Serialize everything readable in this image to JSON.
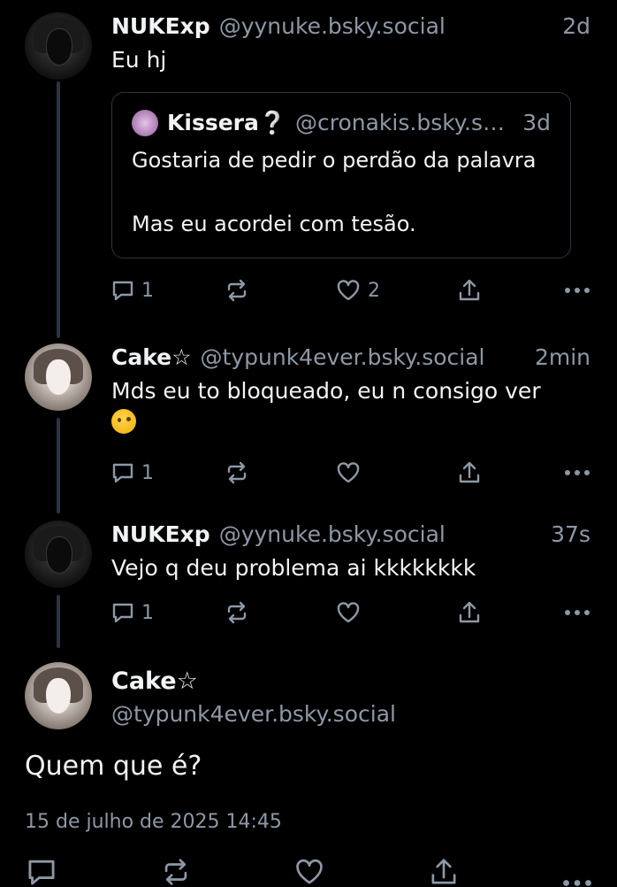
{
  "thread": [
    {
      "name": "NUKExp",
      "handle": "@yynuke.bsky.social",
      "time": "2d",
      "text": "Eu hj",
      "quote": {
        "name": "Kissera❔",
        "handle": "@cronakis.bsky.so...",
        "time": "3d",
        "text": "Gostaria de pedir o perdão da palavra\n\nMas eu acordei com tesão."
      },
      "reply_count": "1",
      "like_count": "2"
    },
    {
      "name": "Cake☆",
      "handle": "@typunk4ever.bsky.social",
      "time": "2min",
      "text": "Mds eu to bloqueado, eu n consigo ver",
      "emoji": "face-with-raised-eyebrow",
      "reply_count": "1"
    },
    {
      "name": "NUKExp",
      "handle": "@yynuke.bsky.social",
      "time": "37s",
      "text": "Vejo q deu problema ai kkkkkkkk",
      "reply_count": "1"
    }
  ],
  "main_post": {
    "name": "Cake☆",
    "handle": "@typunk4ever.bsky.social",
    "text": "Quem que é?",
    "date": "15 de julho de 2025 14:45"
  },
  "colors": {
    "background": "#000000",
    "text": "#f1f3f5",
    "muted": "#8d98a5",
    "thread_line": "#2c3440"
  }
}
